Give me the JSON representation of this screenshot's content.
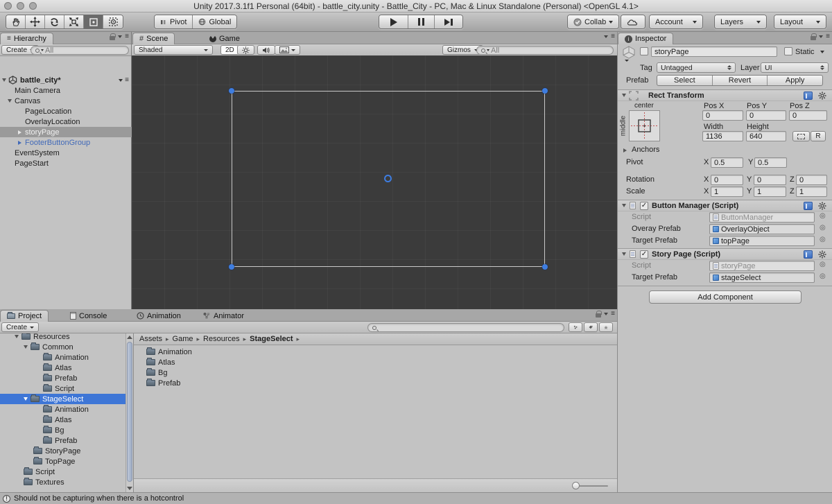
{
  "window": {
    "title": "Unity 2017.3.1f1 Personal (64bit) - battle_city.unity - Battle_City - PC, Mac & Linux Standalone (Personal) <OpenGL 4.1>"
  },
  "icons": {
    "menu": "≡",
    "breadcrumb_sep": "▸",
    "target": "◎",
    "hash": "#",
    "exclaim": "!",
    "check": "✓"
  },
  "toolbar": {
    "pivot": "Pivot",
    "global": "Global",
    "collab": "Collab",
    "account": "Account",
    "layers": "Layers",
    "layout": "Layout"
  },
  "hierarchy": {
    "tab": "Hierarchy",
    "create": "Create",
    "search_placeholder": "All",
    "scene_row": "battle_city*",
    "items": [
      {
        "label": "Main Camera"
      },
      {
        "label": "Canvas"
      },
      {
        "label": "PageLocation"
      },
      {
        "label": "OverlayLocation"
      },
      {
        "label": "storyPage"
      },
      {
        "label": "FooterButtonGroup"
      },
      {
        "label": "EventSystem"
      },
      {
        "label": "PageStart"
      }
    ]
  },
  "scene_view": {
    "tab_scene": "Scene",
    "tab_game": "Game",
    "shaded": "Shaded",
    "mode_2d": "2D",
    "gizmos": "Gizmos",
    "search_placeholder": "All"
  },
  "inspector": {
    "tab": "Inspector",
    "name": "storyPage",
    "static": "Static",
    "tag_label": "Tag",
    "tag": "Untagged",
    "layer_label": "Layer",
    "layer": "UI",
    "prefab_label": "Prefab",
    "select": "Select",
    "revert": "Revert",
    "apply": "Apply",
    "rect": {
      "title": "Rect Transform",
      "anchor_h": "center",
      "anchor_v": "middle",
      "pos_x_label": "Pos X",
      "pos_y_label": "Pos Y",
      "pos_z_label": "Pos Z",
      "pos_x": "0",
      "pos_y": "0",
      "pos_z": "0",
      "width_label": "Width",
      "height_label": "Height",
      "width": "1136",
      "height": "640",
      "r_label": "R",
      "anchors_label": "Anchors",
      "pivot_label": "Pivot",
      "pivot_x": "0.5",
      "pivot_y": "0.5",
      "rotation_label": "Rotation",
      "rot_x": "0",
      "rot_y": "0",
      "rot_z": "0",
      "scale_label": "Scale",
      "scale_x": "1",
      "scale_y": "1",
      "scale_z": "1",
      "x": "X",
      "y": "Y",
      "z": "Z"
    },
    "button_manager": {
      "title": "Button Manager (Script)",
      "script_label": "Script",
      "script": "ButtonManager",
      "overay_label": "Overay Prefab",
      "overay": "OverlayObject",
      "target_label": "Target Prefab",
      "target": "topPage"
    },
    "story_page": {
      "title": "Story Page (Script)",
      "script_label": "Script",
      "script": "storyPage",
      "target_label": "Target Prefab",
      "target": "stageSelect"
    },
    "add_component": "Add Component"
  },
  "project": {
    "tab_project": "Project",
    "tab_console": "Console",
    "tab_animation": "Animation",
    "tab_animator": "Animator",
    "create": "Create",
    "tree": [
      {
        "label": "Resources"
      },
      {
        "label": "Common"
      },
      {
        "label": "Animation"
      },
      {
        "label": "Atlas"
      },
      {
        "label": "Prefab"
      },
      {
        "label": "Script"
      },
      {
        "label": "StageSelect"
      },
      {
        "label": "Animation"
      },
      {
        "label": "Atlas"
      },
      {
        "label": "Bg"
      },
      {
        "label": "Prefab"
      },
      {
        "label": "StoryPage"
      },
      {
        "label": "TopPage"
      },
      {
        "label": "Script"
      },
      {
        "label": "Textures"
      }
    ],
    "breadcrumb": [
      "Assets",
      "Game",
      "Resources",
      "StageSelect"
    ],
    "files": [
      "Animation",
      "Atlas",
      "Bg",
      "Prefab"
    ]
  },
  "status": {
    "message": "Should not be capturing when there is a hotcontrol"
  }
}
